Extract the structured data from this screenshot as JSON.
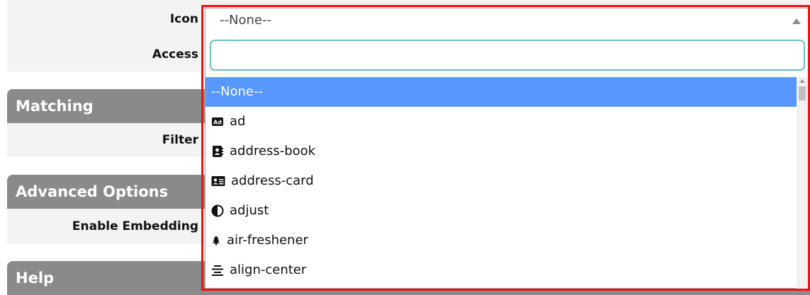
{
  "form": {
    "fields": {
      "icon_label": "Icon",
      "access_label": "Access",
      "filter_label": "Filter",
      "embedding_label": "Enable Embedding"
    },
    "sections": {
      "matching": "Matching",
      "advanced": "Advanced Options",
      "help": "Help"
    }
  },
  "icon_select": {
    "value": "--None--",
    "search_value": "",
    "options": [
      {
        "label": "--None--",
        "icon": "",
        "selected": true
      },
      {
        "label": "ad",
        "icon": "ad-icon",
        "selected": false
      },
      {
        "label": "address-book",
        "icon": "address-book-icon",
        "selected": false
      },
      {
        "label": "address-card",
        "icon": "address-card-icon",
        "selected": false
      },
      {
        "label": "adjust",
        "icon": "adjust-icon",
        "selected": false
      },
      {
        "label": "air-freshener",
        "icon": "air-freshener-icon",
        "selected": false
      },
      {
        "label": "align-center",
        "icon": "align-center-icon",
        "selected": false
      }
    ]
  },
  "colors": {
    "highlight": "#5897fb",
    "section_header": "#8a8a8a",
    "focus_border": "#6cbec6",
    "frame": "#ee1111"
  }
}
